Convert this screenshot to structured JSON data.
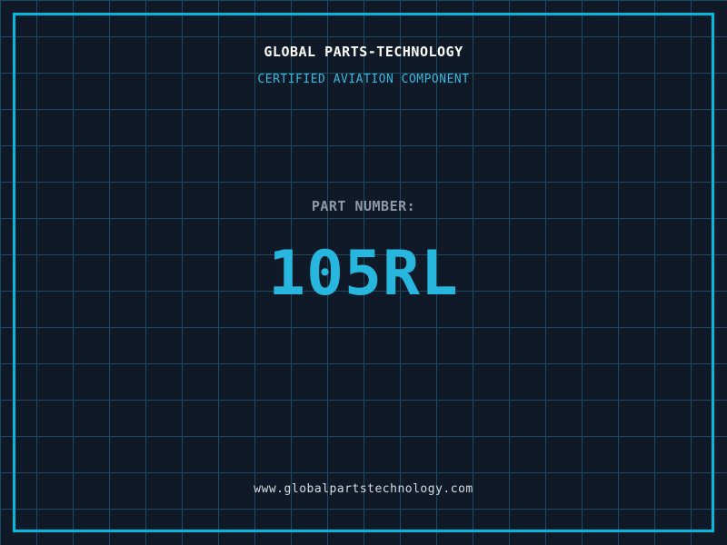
{
  "header": {
    "title": "GLOBAL PARTS-TECHNOLOGY",
    "subtitle": "CERTIFIED AVIATION COMPONENT"
  },
  "part": {
    "label": "PART NUMBER:",
    "number": "105RL"
  },
  "footer": {
    "url": "www.globalpartstechnology.com"
  },
  "colors": {
    "background": "#0f1928",
    "grid_line": "#1b4a5e",
    "frame_border": "#00b9dd",
    "title_text": "#ffffff",
    "subtitle_text": "#38b8de",
    "part_label_text": "#8e98a8",
    "part_number_text": "#27b7de",
    "footer_text": "#d8dbe2"
  }
}
